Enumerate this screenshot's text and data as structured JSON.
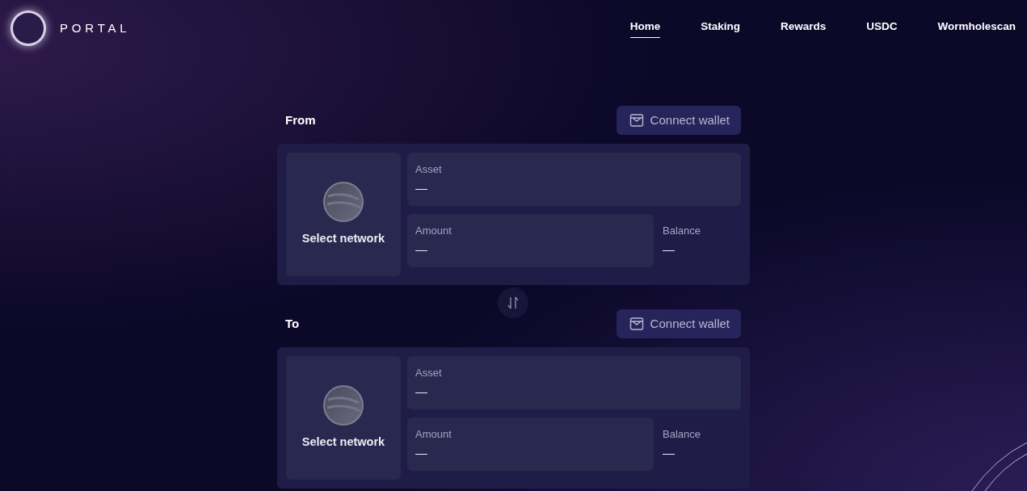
{
  "brand": {
    "name": "PORTAL"
  },
  "nav": [
    {
      "label": "Home",
      "selected": true
    },
    {
      "label": "Staking",
      "selected": false
    },
    {
      "label": "Rewards",
      "selected": false
    },
    {
      "label": "USDC",
      "selected": false
    },
    {
      "label": "Wormholescan",
      "selected": false
    }
  ],
  "sections": [
    {
      "title": "From",
      "wallet_button": "Connect wallet",
      "network_label": "Select network",
      "asset": {
        "label": "Asset",
        "value": "—"
      },
      "amount": {
        "label": "Amount",
        "value": "—"
      },
      "balance": {
        "label": "Balance",
        "value": "—"
      }
    },
    {
      "title": "To",
      "wallet_button": "Connect wallet",
      "network_label": "Select network",
      "asset": {
        "label": "Asset",
        "value": "—"
      },
      "amount": {
        "label": "Amount",
        "value": "—"
      },
      "balance": {
        "label": "Balance",
        "value": "—"
      }
    }
  ]
}
